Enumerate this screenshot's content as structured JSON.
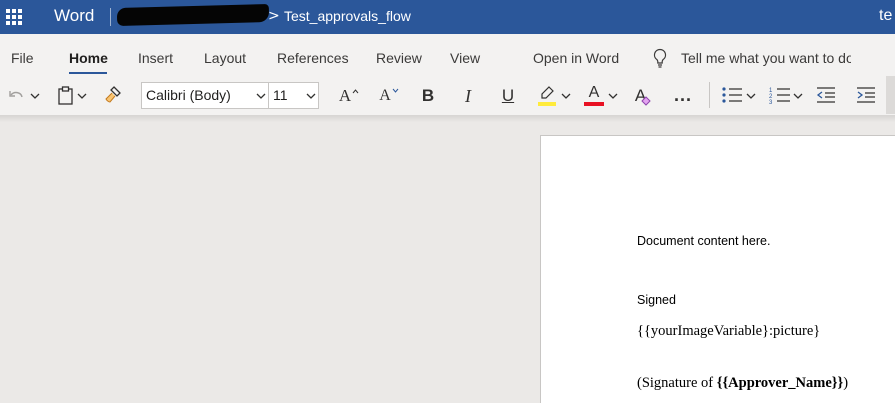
{
  "titlebar": {
    "app_name": "Word",
    "breadcrumb_separator": ">",
    "document_name": "Test_approvals_flow",
    "user_initials": "te",
    "background_color": "#2b579a"
  },
  "ribbon": {
    "tabs": [
      {
        "label": "File"
      },
      {
        "label": "Home",
        "active": true
      },
      {
        "label": "Insert"
      },
      {
        "label": "Layout"
      },
      {
        "label": "References"
      },
      {
        "label": "Review"
      },
      {
        "label": "View"
      },
      {
        "label": "Open in Word"
      }
    ],
    "tell_me": "Tell me what you want to do",
    "font": {
      "name": "Calibri (Body)",
      "size": "11"
    },
    "buttons": {
      "increase_font": "A",
      "decrease_font": "A",
      "bold": "B",
      "italic": "I",
      "underline": "U",
      "font_color": "A",
      "clear_formatting": "A",
      "more": "..."
    },
    "highlight_color": "#ffeb3b",
    "font_color_value": "#e81123"
  },
  "document": {
    "line1": "Document content here.",
    "line2": "Signed",
    "line3": "{{yourImageVariable}:picture}",
    "line4_prefix": "(Signature of ",
    "line4_bold": "{{Approver_Name}}",
    "line4_suffix": ")"
  }
}
